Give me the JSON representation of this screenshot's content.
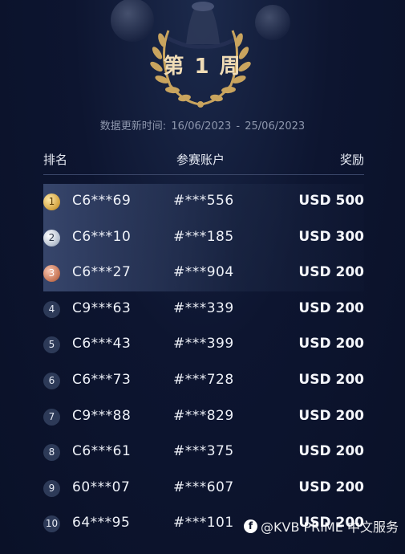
{
  "header": {
    "week_title": "第 1 周",
    "update_label": "数据更新时间:",
    "date_from": "16/06/2023",
    "date_sep": "-",
    "date_to": "25/06/2023"
  },
  "table": {
    "col_rank": "排名",
    "col_account": "参赛账户",
    "col_reward": "奖励",
    "rows": [
      {
        "rank": "1",
        "name": "C6***69",
        "account": "#***556",
        "reward": "USD 500",
        "medal": "gold"
      },
      {
        "rank": "2",
        "name": "C6***10",
        "account": "#***185",
        "reward": "USD 300",
        "medal": "silver"
      },
      {
        "rank": "3",
        "name": "C6***27",
        "account": "#***904",
        "reward": "USD 200",
        "medal": "bronze"
      },
      {
        "rank": "4",
        "name": "C9***63",
        "account": "#***339",
        "reward": "USD 200",
        "medal": "plain"
      },
      {
        "rank": "5",
        "name": "C6***43",
        "account": "#***399",
        "reward": "USD 200",
        "medal": "plain"
      },
      {
        "rank": "6",
        "name": "C6***73",
        "account": "#***728",
        "reward": "USD 200",
        "medal": "plain"
      },
      {
        "rank": "7",
        "name": "C9***88",
        "account": "#***829",
        "reward": "USD 200",
        "medal": "plain"
      },
      {
        "rank": "8",
        "name": "C6***61",
        "account": "#***375",
        "reward": "USD 200",
        "medal": "plain"
      },
      {
        "rank": "9",
        "name": "60***07",
        "account": "#***607",
        "reward": "USD 200",
        "medal": "plain"
      },
      {
        "rank": "10",
        "name": "64***95",
        "account": "#***101",
        "reward": "USD 200",
        "medal": "plain"
      }
    ]
  },
  "watermark": {
    "text": "@KVB PRIME 中文服务",
    "icon": "facebook-icon"
  },
  "colors": {
    "background": "#0d1530",
    "gold_text": "#f0dcb6",
    "laurel": "#c9a45e"
  }
}
